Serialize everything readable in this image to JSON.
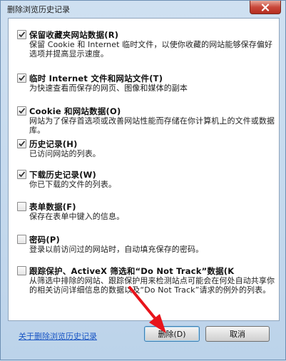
{
  "window": {
    "title": "删除浏览历史记录"
  },
  "options": [
    {
      "checked": true,
      "label": "保留收藏夹网站数据(R)",
      "desc": "保留 Cookie 和 Internet 临时文件，以使你收藏的网站能够保存偏好选项并提高显示速度。"
    },
    {
      "checked": true,
      "label": "临时 Internet 文件和网站文件(T)",
      "desc": "为快速查看而保存的网页、图像和媒体的副本"
    },
    {
      "checked": true,
      "label": "Cookie 和网站数据(O)",
      "desc": "网站为了保存首选项或改善网站性能而存储在你计算机上的文件或数据库。"
    },
    {
      "checked": true,
      "label": "历史记录(H)",
      "desc": "已访问网站的列表。"
    },
    {
      "checked": true,
      "label": "下载历史记录(W)",
      "desc": "你已下载的文件的列表。"
    },
    {
      "checked": false,
      "label": "表单数据(F)",
      "desc": "保存在表单中键入的信息。"
    },
    {
      "checked": false,
      "label": "密码(P)",
      "desc": "登录以前访问过的网站时，自动填充保存的密码。"
    },
    {
      "checked": false,
      "label": "跟踪保护、ActiveX 筛选和“Do Not Track”数据(K",
      "desc": "从筛选中排除的网站、跟踪保护用来检测站点可能会在何处自动共享你的相关访问详细信息的数据以及“Do Not Track”请求的例外的列表。"
    }
  ],
  "footer": {
    "link": "关于删除浏览历史记录",
    "delete_label": "删除(D)",
    "cancel_label": "取消"
  },
  "icons": {
    "close": "close-icon",
    "check": "checkmark-icon"
  }
}
